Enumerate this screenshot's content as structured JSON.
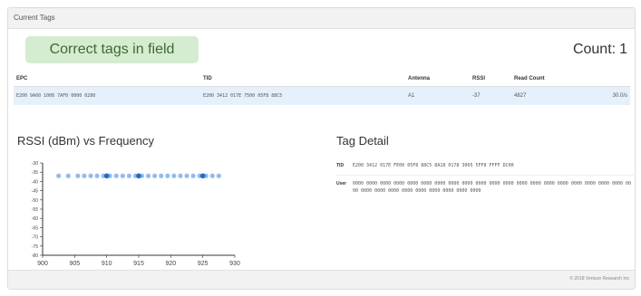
{
  "panel": {
    "title": "Current Tags"
  },
  "status": {
    "alert": "Correct tags in field",
    "count_label": "Count:",
    "count_value": "1"
  },
  "table": {
    "headers": [
      "EPC",
      "TID",
      "Antenna",
      "RSSI",
      "Read Count",
      ""
    ],
    "rows": [
      [
        "E200 9A60 1006 7AF0 0000 0280",
        "E200 3412 017E 7500 05F8 88C5",
        "A1",
        "-37",
        "4827",
        "30.0/s"
      ]
    ]
  },
  "chart": {
    "title": "RSSI (dBm) vs Frequency"
  },
  "chart_data": {
    "type": "scatter",
    "title": "RSSI (dBm) vs Frequency",
    "xlabel": "",
    "ylabel": "",
    "xlim": [
      900,
      930
    ],
    "ylim": [
      -80,
      -30
    ],
    "grid": false,
    "x_ticks": [
      900,
      905,
      910,
      915,
      920,
      925,
      930
    ],
    "y_ticks": [
      -30,
      -35,
      -40,
      -45,
      -50,
      -55,
      -60,
      -65,
      -70,
      -75,
      -80
    ],
    "series": [
      {
        "color": "#3a86d4",
        "x": [
          902.5,
          904,
          905.5,
          906.5,
          907.5,
          908.5,
          909.5,
          910.5,
          911.5,
          912.5,
          913.5,
          914.5,
          915.5,
          916.5,
          917.5,
          918.5,
          919.5,
          920.5,
          921.5,
          922.5,
          923.5,
          924.5,
          925.5,
          926.5,
          927.5
        ],
        "y": [
          -37,
          -37,
          -37,
          -37,
          -37,
          -37,
          -37,
          -37,
          -37,
          -37,
          -37,
          -37,
          -37,
          -37,
          -37,
          -37,
          -37,
          -37,
          -37,
          -37,
          -37,
          -37,
          -37,
          -37,
          -37
        ]
      }
    ],
    "highlight_points": [
      {
        "x": 910,
        "y": -37
      },
      {
        "x": 915,
        "y": -37
      },
      {
        "x": 925,
        "y": -37
      }
    ]
  },
  "detail": {
    "title": "Tag Detail",
    "tid_label": "TID",
    "tid_value": "E200 3412 017E FE00 05F8 88C5 8A18 0178 3005 5FF8 FFFF DC00",
    "user_label": "User",
    "user_value": "0000 0000 0000 0000 0000 0000 0000 0000 0000 0000 0000 0000 0000 0000 0000 0000 0000 0000 0000 0000 0000 0000 0000 0000 0000 0000 0000 0000 0000 0000"
  },
  "footer": {
    "copyright": "© 2018 Venture Research Inc"
  }
}
